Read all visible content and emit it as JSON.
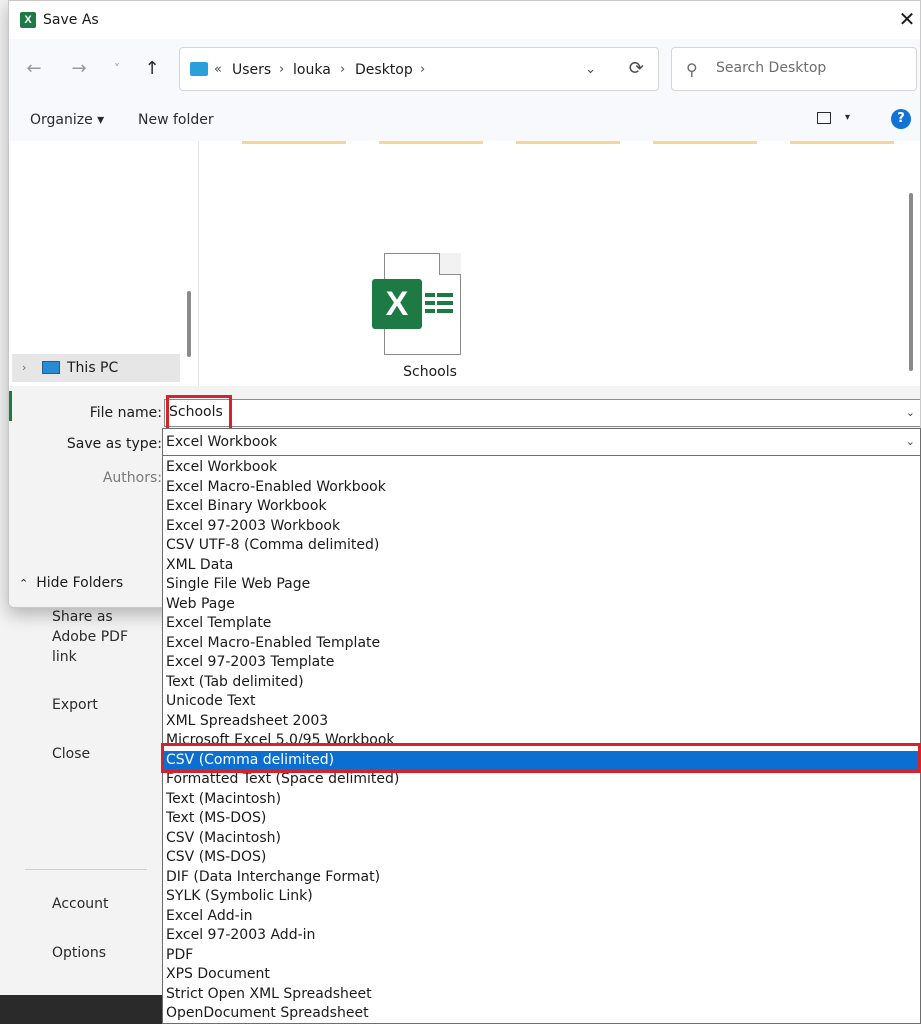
{
  "backstage": {
    "items": [
      "Share as Adobe PDF link",
      "Export",
      "Close",
      "Account",
      "Options"
    ]
  },
  "dialog": {
    "title": "Save As",
    "close_glyph": "✕",
    "nav": {
      "back_glyph": "←",
      "forward_glyph": "→",
      "recent_glyph": "˅",
      "up_glyph": "↑",
      "breadcrumb_prefix": "«",
      "breadcrumb": [
        "Users",
        "louka",
        "Desktop"
      ],
      "breadcrumb_sep": "›",
      "address_chevron": "⌄",
      "refresh_glyph": "⟳"
    },
    "search": {
      "placeholder": "Search Desktop",
      "icon_glyph": "⚲"
    },
    "toolbar": {
      "organize": "Organize ▾",
      "new_folder": "New folder",
      "view_caret": "▾",
      "help_glyph": "?"
    },
    "navpane": {
      "this_pc": "This PC",
      "chevron_glyph": "›"
    },
    "files": [
      {
        "name": "Schools",
        "type": "Excel workbook",
        "icon": "excel-file-icon"
      }
    ],
    "form": {
      "file_name_label": "File name:",
      "file_name_value": "Schools",
      "save_as_type_label": "Save as type:",
      "save_as_type_value": "Excel Workbook",
      "authors_label": "Authors:",
      "hide_folders": "Hide Folders",
      "hide_folders_caret": "⌃",
      "dropdown_chevron": "⌄"
    }
  },
  "save_as_type_options": [
    "Excel Workbook",
    "Excel Macro-Enabled Workbook",
    "Excel Binary Workbook",
    "Excel 97-2003 Workbook",
    "CSV UTF-8 (Comma delimited)",
    "XML Data",
    "Single File Web Page",
    "Web Page",
    "Excel Template",
    "Excel Macro-Enabled Template",
    "Excel 97-2003 Template",
    "Text (Tab delimited)",
    "Unicode Text",
    "XML Spreadsheet 2003",
    "Microsoft Excel 5.0/95 Workbook",
    "CSV (Comma delimited)",
    "Formatted Text (Space delimited)",
    "Text (Macintosh)",
    "Text (MS-DOS)",
    "CSV (Macintosh)",
    "CSV (MS-DOS)",
    "DIF (Data Interchange Format)",
    "SYLK (Symbolic Link)",
    "Excel Add-in",
    "Excel 97-2003 Add-in",
    "PDF",
    "XPS Document",
    "Strict Open XML Spreadsheet",
    "OpenDocument Spreadsheet"
  ],
  "selected_option_index": 15,
  "colors": {
    "excel_green": "#1d7a45",
    "selection_blue": "#0a6fd1",
    "annotation_red": "#d6232a",
    "help_blue": "#1173d4"
  }
}
